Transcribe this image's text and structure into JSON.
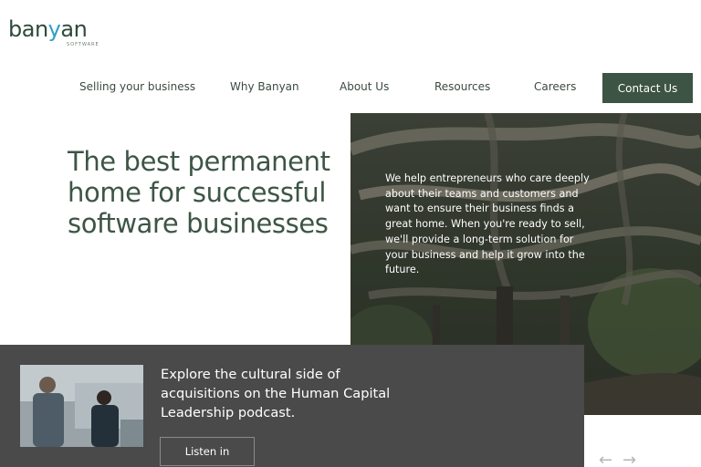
{
  "logo": {
    "word_a": "ban",
    "word_y": "y",
    "word_b": "an",
    "sub": "SOFTWARE"
  },
  "nav": {
    "items": [
      {
        "label": "Selling your business"
      },
      {
        "label": "Why Banyan"
      },
      {
        "label": "About Us"
      },
      {
        "label": "Resources"
      },
      {
        "label": "Careers"
      }
    ],
    "contact_label": "Contact Us"
  },
  "hero": {
    "title": "The best permanent home for successful software businesses",
    "body": "We help entrepreneurs who care deeply about their teams and customers and want to ensure their business finds a great home. When you're ready to sell, we'll provide a long-term solution for your business and help it grow into the future."
  },
  "banner": {
    "text": "Explore the cultural side of acquisitions on the Human Capital Leadership podcast.",
    "button_label": "Listen in"
  },
  "carousel": {
    "prev": "←",
    "next": "→"
  },
  "colors": {
    "brand_green": "#3d5343",
    "banner_bg": "#4a4a4a",
    "logo_accent": "#2f9fc0"
  },
  "icons": {
    "prev": "arrow-left-icon",
    "next": "arrow-right-icon"
  }
}
